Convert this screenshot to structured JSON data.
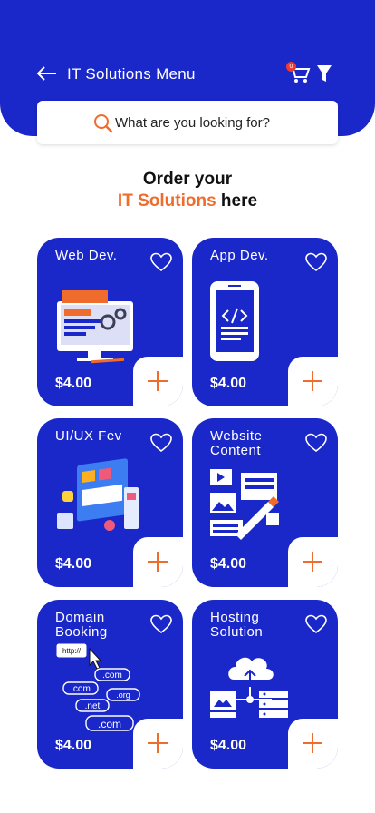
{
  "header": {
    "title": "IT Solutions Menu",
    "cart_count": "0",
    "back_icon": "arrow-left-icon",
    "cart_icon": "cart-icon",
    "filter_icon": "filter-icon"
  },
  "search": {
    "placeholder": "What are you looking for?"
  },
  "headline": {
    "line1": "Order your",
    "accent": "IT Solutions",
    "rest": " here"
  },
  "colors": {
    "primary": "#1a27c9",
    "accent": "#ef6c2c",
    "badge": "#ef3b2d"
  },
  "cards": [
    {
      "title": "Web Dev.",
      "price": "$4.00"
    },
    {
      "title": "App Dev.",
      "price": "$4.00"
    },
    {
      "title": "UI/UX Fev",
      "price": "$4.00"
    },
    {
      "title": "Website Content",
      "price": "$4.00"
    },
    {
      "title": "Domain Booking",
      "price": "$4.00"
    },
    {
      "title": "Hosting Solution",
      "price": "$4.00"
    }
  ],
  "domain_labels": [
    "http://",
    ".com",
    ".com",
    ".org",
    ".net",
    ".com"
  ]
}
